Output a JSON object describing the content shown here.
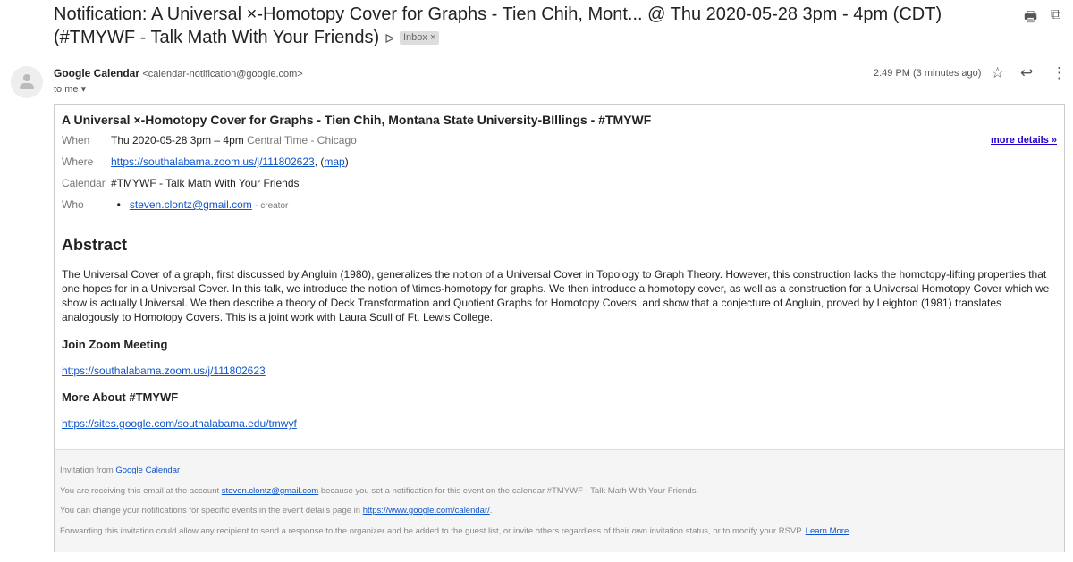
{
  "subject": {
    "text": "Notification: A Universal ×-Homotopy Cover for Graphs - Tien Chih, Mont... @ Thu 2020-05-28 3pm - 4pm (CDT) (#TMYWF - Talk Math With Your Friends)",
    "label": "Inbox",
    "label_close": "×"
  },
  "sender": {
    "name": "Google Calendar",
    "email": "<calendar-notification@google.com>",
    "to": "to me",
    "time": "2:49 PM (3 minutes ago)"
  },
  "event": {
    "title": "A Universal ×-Homotopy Cover for Graphs - Tien Chih, Montana State University-BIllings - #TMYWF",
    "more_details": "more details »",
    "when_label": "When",
    "when": "Thu 2020-05-28 3pm – 4pm",
    "when_tz": "Central Time - Chicago",
    "where_label": "Where",
    "where_link": "https://southalabama.zoom.us/j/111802623",
    "map": "map",
    "calendar_label": "Calendar",
    "calendar": "#TMYWF - Talk Math With Your Friends",
    "who_label": "Who",
    "who_email": "steven.clontz@gmail.com",
    "who_role": "- creator"
  },
  "abstract": {
    "heading": "Abstract",
    "text": "The Universal Cover of a graph, first discussed by Angluin (1980), generalizes the notion of a Universal Cover in Topology to Graph Theory.  However, this construction lacks the homotopy-lifting properties that one hopes for in a Universal Cover.  In this talk, we introduce the notion of \\times-homotopy for graphs.  We then introduce a homotopy cover, as well as a construction for a Universal Homotopy Cover which we show is actually Universal.  We then describe a theory of Deck Transformation and Quotient Graphs for Homotopy Covers, and show that a conjecture of Angluin, proved by Leighton (1981) translates analogously to Homotopy Covers.  This is a joint work with Laura Scull of Ft. Lewis College."
  },
  "zoom": {
    "heading": "Join Zoom Meeting",
    "link": "https://southalabama.zoom.us/j/111802623"
  },
  "more": {
    "heading": "More About #TMYWF",
    "link": "https://sites.google.com/southalabama.edu/tmwyf"
  },
  "footer": {
    "l1_a": "Invitation from ",
    "l1_link": "Google Calendar",
    "l2_a": "You are receiving this email at the account ",
    "l2_link": "steven.clontz@gmail.com",
    "l2_b": " because you set a notification for this event on the calendar #TMYWF - Talk Math With Your Friends.",
    "l3_a": "You can change your notifications for specific events in the event details page in ",
    "l3_link": "https://www.google.com/calendar/",
    "l3_b": ".",
    "l4_a": "Forwarding this invitation could allow any recipient to send a response to the organizer and be added to the guest list, or invite others regardless of their own invitation status, or to modify your RSVP. ",
    "l4_link": "Learn More",
    "l4_b": "."
  }
}
